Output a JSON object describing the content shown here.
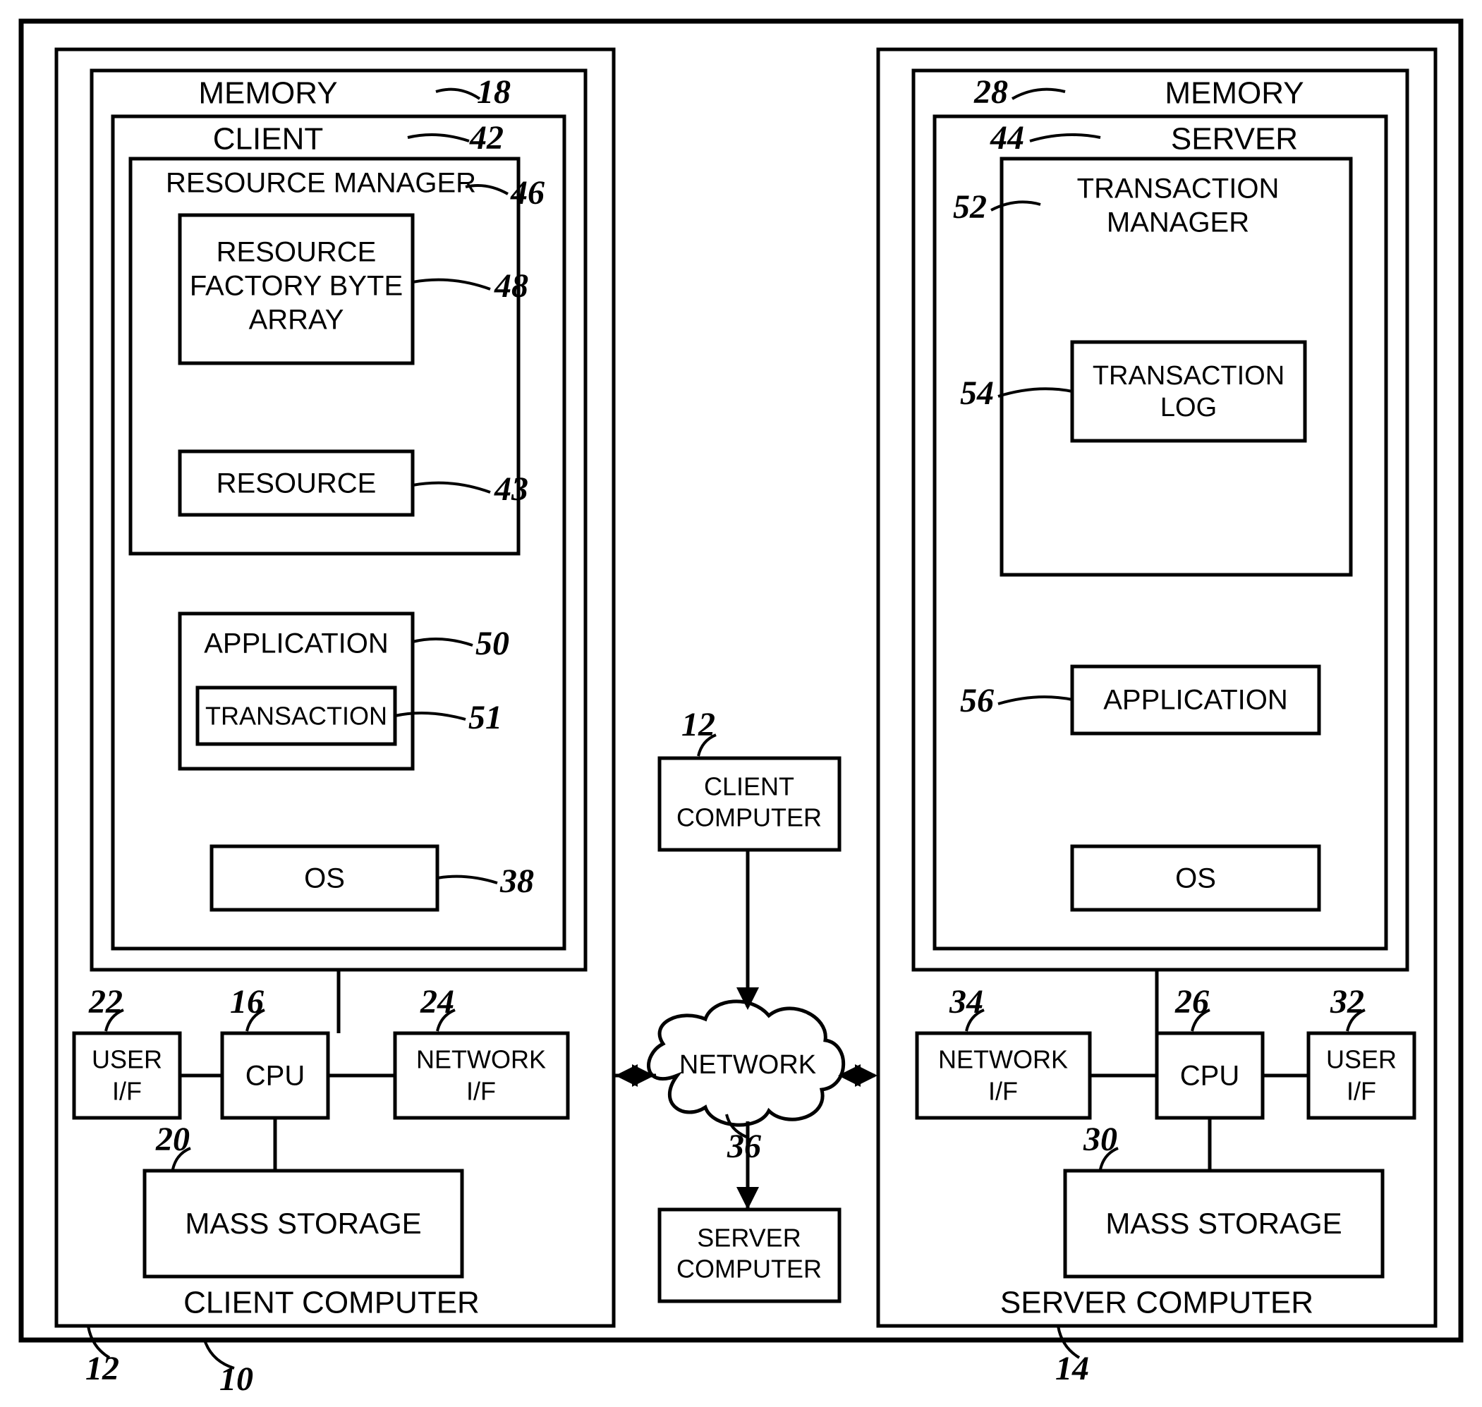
{
  "outerSystem": {
    "ref": "10"
  },
  "client": {
    "title": "CLIENT COMPUTER",
    "ref": "12",
    "memory": {
      "label": "MEMORY",
      "ref": "18"
    },
    "clientBox": {
      "label": "CLIENT",
      "ref": "42"
    },
    "resourceManager": {
      "label": "RESOURCE MANAGER",
      "ref": "46"
    },
    "resourceFactory": {
      "label": "RESOURCE FACTORY BYTE ARRAY",
      "ref": "48"
    },
    "resource": {
      "label": "RESOURCE",
      "ref": "43"
    },
    "application": {
      "label": "APPLICATION",
      "ref": "50"
    },
    "transaction": {
      "label": "TRANSACTION",
      "ref": "51"
    },
    "os": {
      "label": "OS",
      "ref": "38"
    },
    "userIF": {
      "label1": "USER",
      "label2": "I/F",
      "ref": "22"
    },
    "cpu": {
      "label": "CPU",
      "ref": "16"
    },
    "networkIF": {
      "label1": "NETWORK",
      "label2": "I/F",
      "ref": "24"
    },
    "massStorage": {
      "label": "MASS STORAGE",
      "ref": "20"
    }
  },
  "server": {
    "title": "SERVER COMPUTER",
    "ref": "14",
    "memory": {
      "label": "MEMORY",
      "ref": "28"
    },
    "serverBox": {
      "label": "SERVER",
      "ref": "44"
    },
    "txManager": {
      "label1": "TRANSACTION",
      "label2": "MANAGER",
      "ref": "52"
    },
    "txLog": {
      "label1": "TRANSACTION",
      "label2": "LOG",
      "ref": "54"
    },
    "application": {
      "label": "APPLICATION",
      "ref": "56"
    },
    "os": {
      "label": "OS"
    },
    "userIF": {
      "label1": "USER",
      "label2": "I/F",
      "ref": "32"
    },
    "cpu": {
      "label": "CPU",
      "ref": "26"
    },
    "networkIF": {
      "label1": "NETWORK",
      "label2": "I/F",
      "ref": "34"
    },
    "massStorage": {
      "label": "MASS STORAGE",
      "ref": "30"
    }
  },
  "center": {
    "clientComputer": {
      "label1": "CLIENT",
      "label2": "COMPUTER",
      "ref": "12"
    },
    "serverComputer": {
      "label1": "SERVER",
      "label2": "COMPUTER"
    },
    "network": {
      "label": "NETWORK",
      "ref": "36"
    }
  }
}
